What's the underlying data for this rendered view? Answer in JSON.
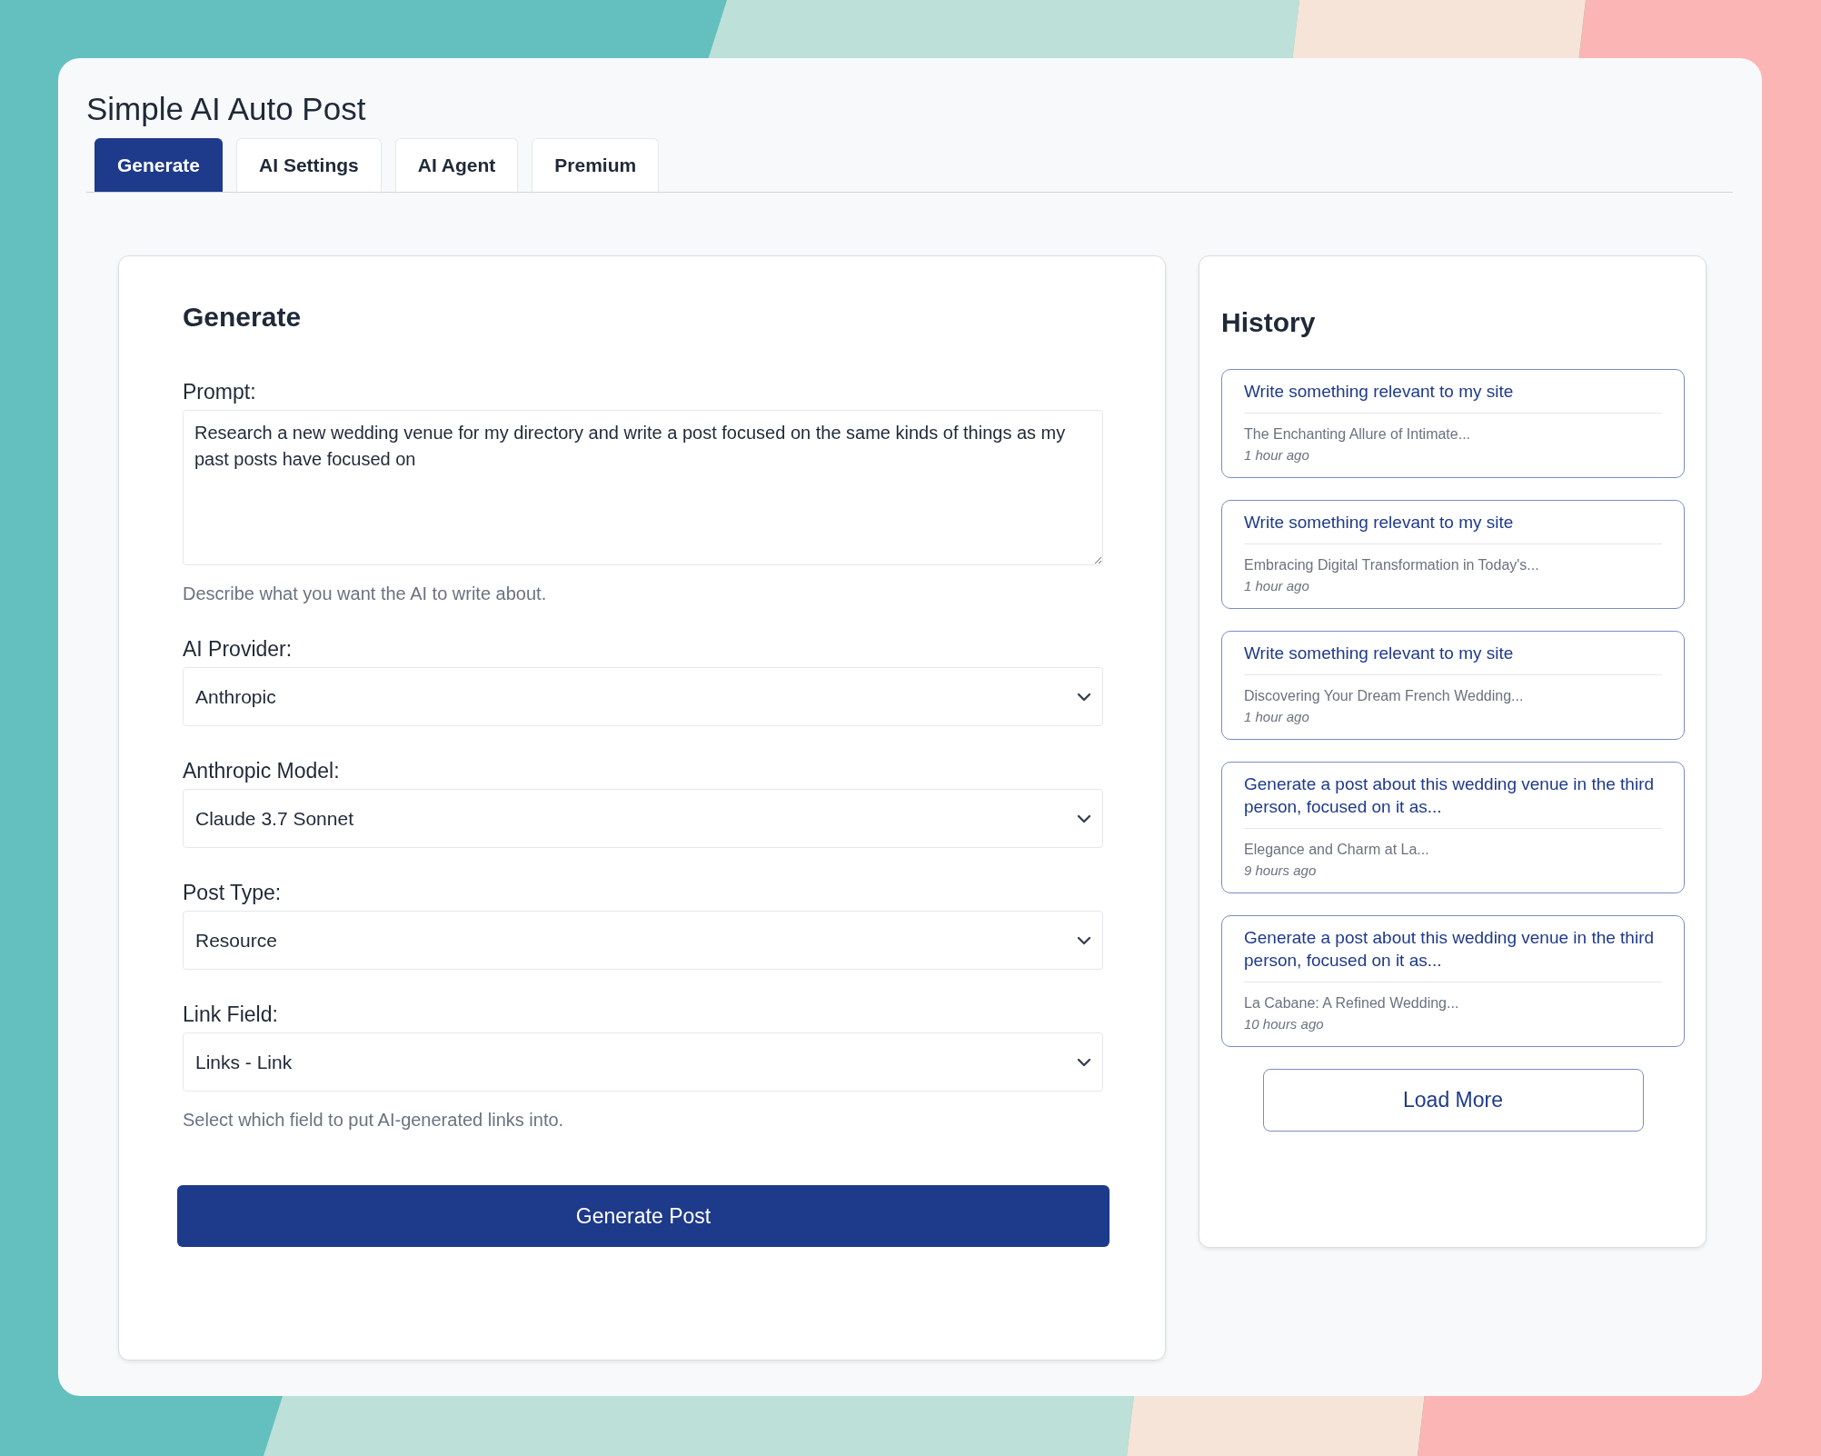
{
  "app_title": "Simple AI Auto Post",
  "tabs": [
    {
      "label": "Generate",
      "selected": true
    },
    {
      "label": "AI Settings",
      "selected": false
    },
    {
      "label": "AI Agent",
      "selected": false
    },
    {
      "label": "Premium",
      "selected": false
    }
  ],
  "generate_panel": {
    "heading": "Generate",
    "fields": [
      {
        "kind": "textarea",
        "label": "Prompt:",
        "value": "Research a new wedding venue for my directory and write a post focused on the same kinds of things as my past posts have focused on",
        "help": "Describe what you want the AI to write about."
      },
      {
        "kind": "select",
        "label": "AI Provider:",
        "value": "Anthropic"
      },
      {
        "kind": "select",
        "label": "Anthropic Model:",
        "value": "Claude 3.7 Sonnet"
      },
      {
        "kind": "select",
        "label": "Post Type:",
        "value": "Resource"
      },
      {
        "kind": "select",
        "label": "Link Field:",
        "value": "Links - Link",
        "help": "Select which field to put AI-generated links into."
      }
    ],
    "button": "Generate Post"
  },
  "history": {
    "heading": "History",
    "items": [
      {
        "prompt": "Write something relevant to my site",
        "title": "The Enchanting Allure of Intimate...",
        "time": "1 hour ago"
      },
      {
        "prompt": "Write something relevant to my site",
        "title": "Embracing Digital Transformation in Today's...",
        "time": "1 hour ago"
      },
      {
        "prompt": "Write something relevant to my site",
        "title": "Discovering Your Dream French Wedding...",
        "time": "1 hour ago"
      },
      {
        "prompt": "Generate a post about this wedding venue in the third person, focused on it as...",
        "title": "Elegance and Charm at La...",
        "time": "9 hours ago"
      },
      {
        "prompt": "Generate a post about this wedding venue in the third person, focused on it as...",
        "title": "La Cabane: A Refined Wedding...",
        "time": "10 hours ago"
      }
    ],
    "load_more": "Load More"
  }
}
